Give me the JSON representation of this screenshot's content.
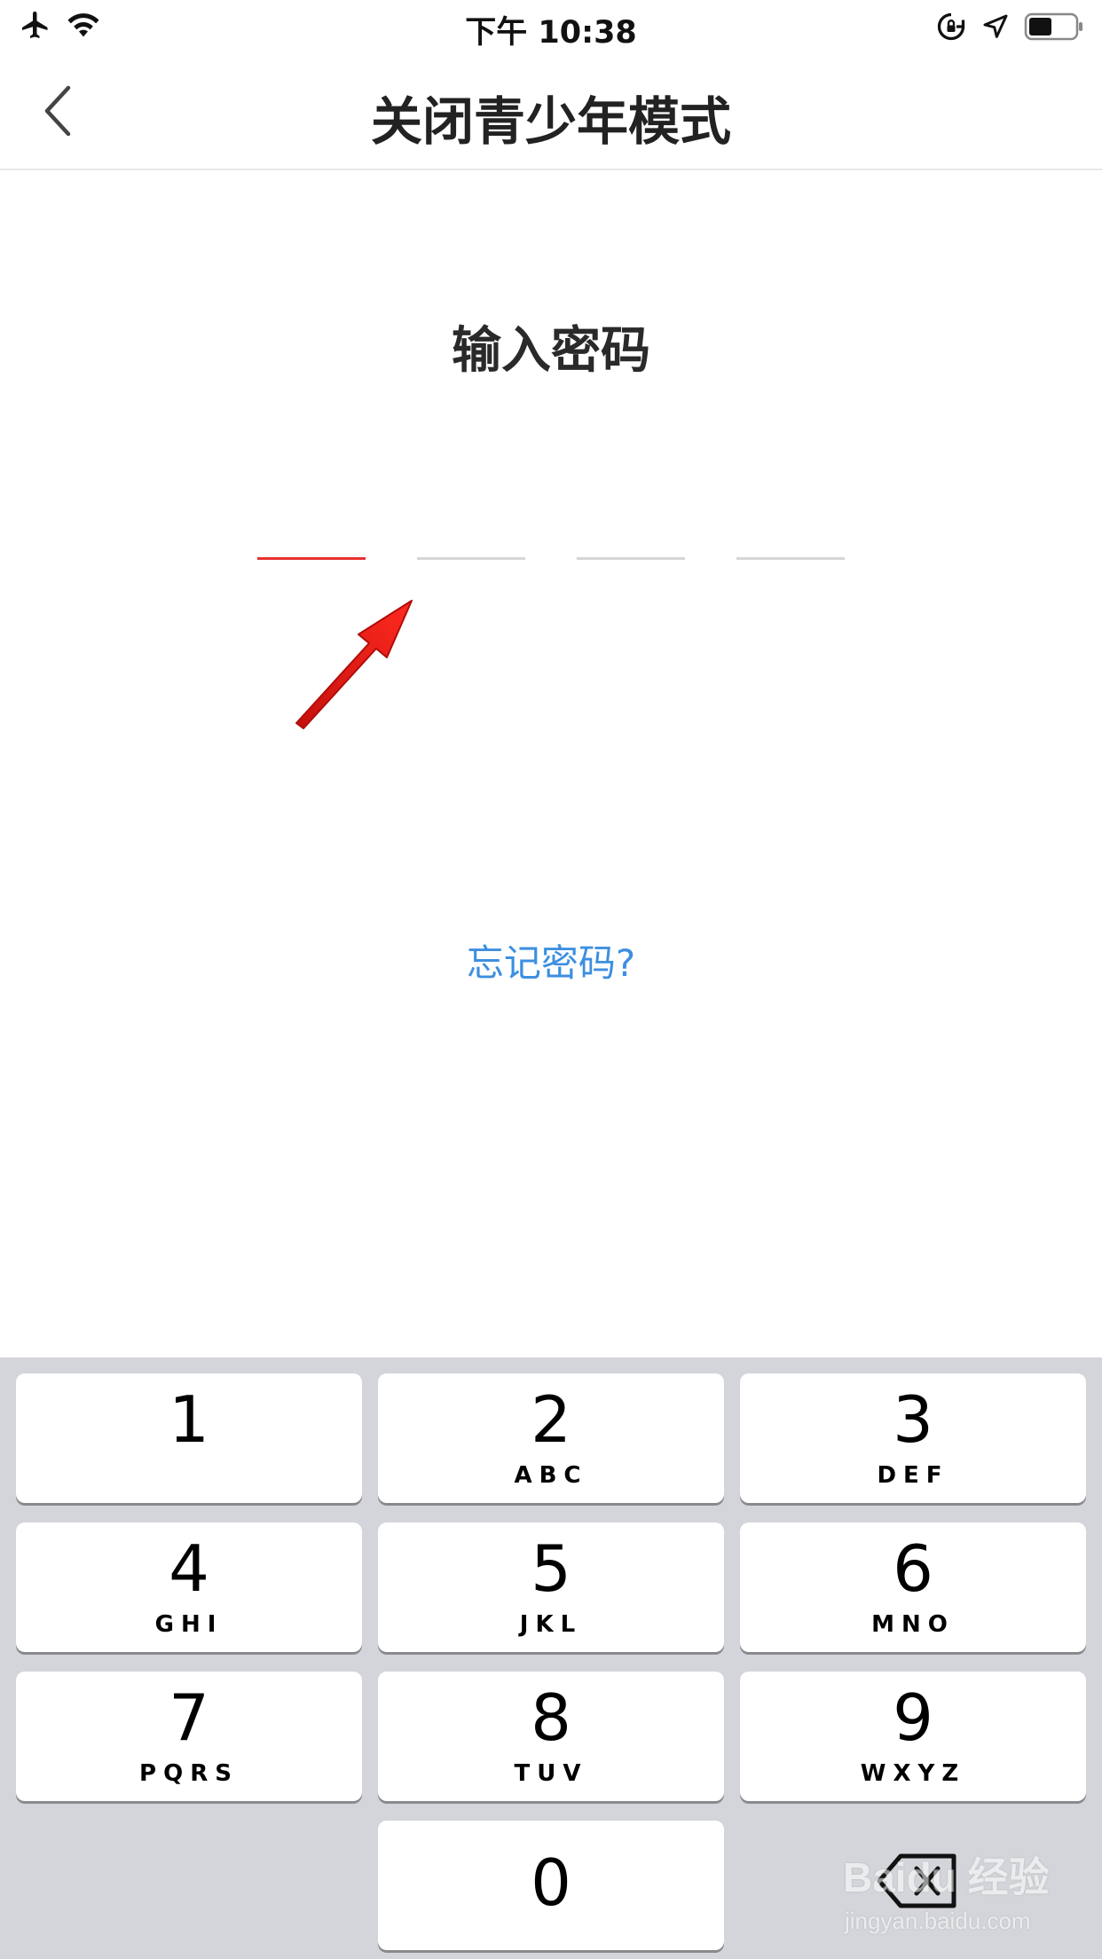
{
  "status_bar": {
    "time": "下午 10:38",
    "left_icons": [
      "airplane-icon",
      "wifi-icon"
    ],
    "right_icons": [
      "rotation-lock-icon",
      "location-icon",
      "battery-icon"
    ],
    "battery_level": 0.5
  },
  "nav": {
    "back_icon": "chevron-left-icon",
    "title": "关闭青少年模式"
  },
  "main": {
    "prompt": "输入密码",
    "pin_length": 4,
    "pin_active_index": 0,
    "forgot_link": "忘记密码?"
  },
  "colors": {
    "active_slot": "#e8302f",
    "inactive_slot": "#d6d6d6",
    "link": "#3d8fe0",
    "keypad_bg": "#d3d5da"
  },
  "keypad": {
    "keys": [
      {
        "digit": "1",
        "letters": ""
      },
      {
        "digit": "2",
        "letters": "ABC"
      },
      {
        "digit": "3",
        "letters": "DEF"
      },
      {
        "digit": "4",
        "letters": "GHI"
      },
      {
        "digit": "5",
        "letters": "JKL"
      },
      {
        "digit": "6",
        "letters": "MNO"
      },
      {
        "digit": "7",
        "letters": "PQRS"
      },
      {
        "digit": "8",
        "letters": "TUV"
      },
      {
        "digit": "9",
        "letters": "WXYZ"
      },
      {
        "digit": "0",
        "letters": ""
      }
    ],
    "delete_icon": "backspace-icon"
  },
  "watermark": {
    "brand": "Baidu 经验",
    "url": "jingyan.baidu.com"
  }
}
